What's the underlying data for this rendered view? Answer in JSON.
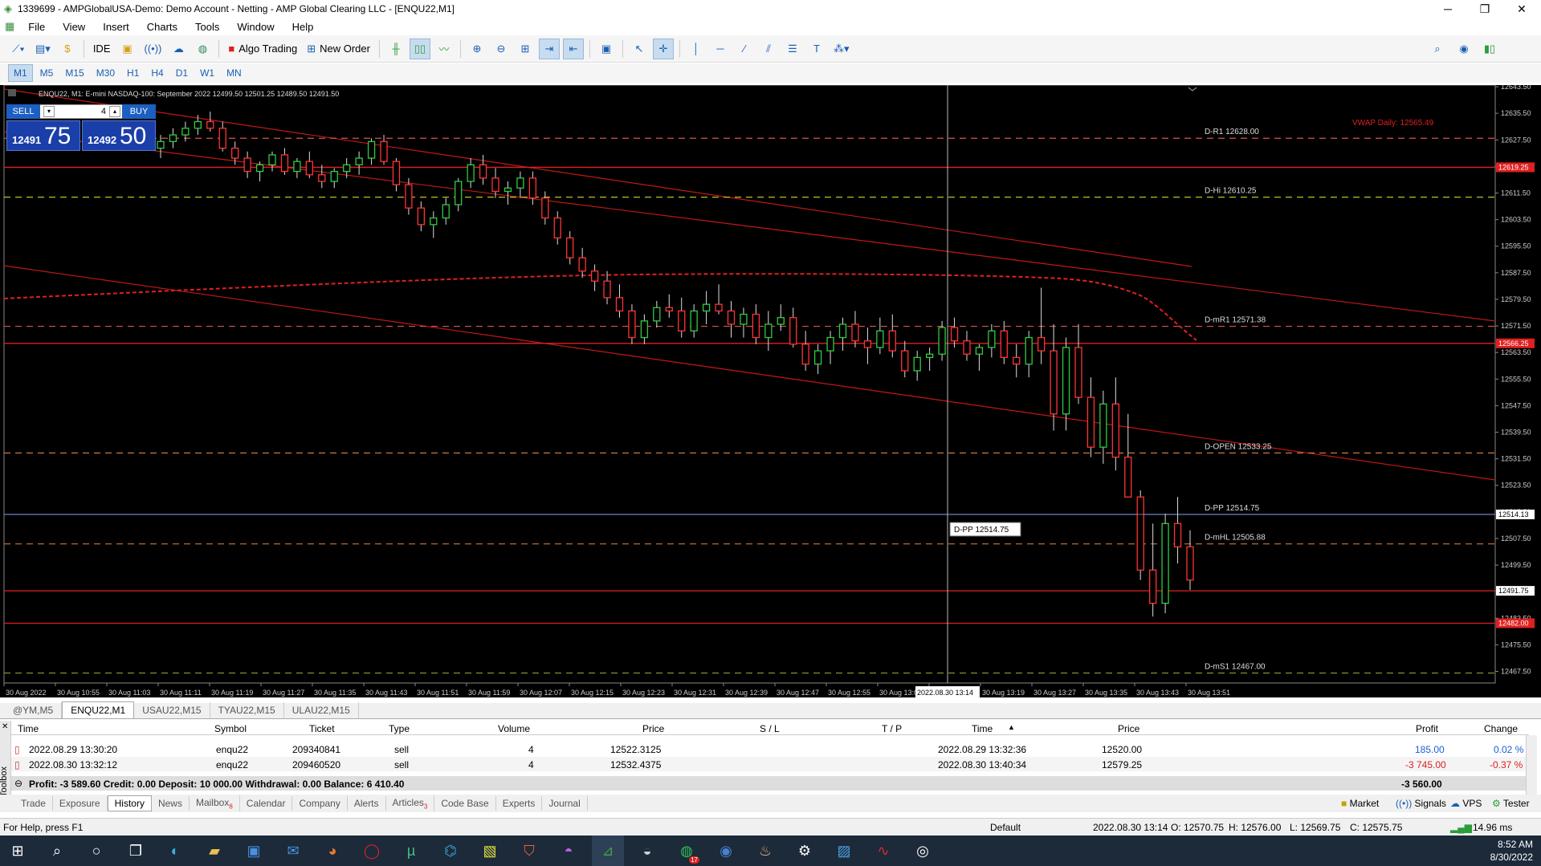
{
  "window": {
    "title": "1339699 - AMPGlobalUSA-Demo: Demo Account - Netting - AMP Global Clearing LLC - [ENQU22,M1]"
  },
  "menu": [
    "File",
    "View",
    "Insert",
    "Charts",
    "Tools",
    "Window",
    "Help"
  ],
  "toolbar": {
    "ide_label": "IDE",
    "algo_label": "Algo Trading",
    "neworder_label": "New Order"
  },
  "timeframes": [
    "M1",
    "M5",
    "M15",
    "M30",
    "H1",
    "H4",
    "D1",
    "W1",
    "MN"
  ],
  "active_timeframe": "M1",
  "chart": {
    "header": "ENQU22, M1:  E-mini NASDAQ-100: September 2022  12499.50 12501.25 12489.50 12491.50",
    "vwap_label": "VWAP Daily: 12565.49",
    "crosshair_label": "D-PP  12514.75",
    "crosshair_time": "2022.08.30 13:14",
    "price_tag_current": "12491.75",
    "price_tag_1": "12619.25",
    "price_tag_2": "12566.25",
    "price_tag_3": "12514.13",
    "price_tag_4": "12482.00"
  },
  "trade_panel": {
    "sell_label": "SELL",
    "buy_label": "BUY",
    "volume": "4",
    "sell_big": "75",
    "sell_small": "12491",
    "buy_big": "50",
    "buy_small": "12492"
  },
  "chart_data": {
    "type": "candlestick",
    "title": "ENQU22, M1: E-mini NASDAQ-100: September 2022",
    "ylim": [
      12464,
      12644
    ],
    "y_ticks": [
      "12643.50",
      "12635.50",
      "12627.50",
      "12619.50",
      "12611.50",
      "12603.50",
      "12595.50",
      "12587.50",
      "12579.50",
      "12571.50",
      "12563.50",
      "12555.50",
      "12547.50",
      "12539.50",
      "12531.50",
      "12523.50",
      "12515.50",
      "12507.50",
      "12499.50",
      "12491.50",
      "12483.50",
      "12475.50",
      "12467.50"
    ],
    "x_ticks": [
      "30 Aug 2022",
      "30 Aug 10:55",
      "30 Aug 11:03",
      "30 Aug 11:11",
      "30 Aug 11:19",
      "30 Aug 11:27",
      "30 Aug 11:35",
      "30 Aug 11:43",
      "30 Aug 11:51",
      "30 Aug 11:59",
      "30 Aug 12:07",
      "30 Aug 12:15",
      "30 Aug 12:23",
      "30 Aug 12:31",
      "30 Aug 12:39",
      "30 Aug 12:47",
      "30 Aug 12:55",
      "30 Aug 13:03",
      "30 Aug 13:11",
      "30 Aug 13:19",
      "30 Aug 13:27",
      "30 Aug 13:35",
      "30 Aug 13:43",
      "30 Aug 13:51"
    ],
    "levels": [
      {
        "name": "D-R1",
        "price": 12628.0,
        "label": "D-R1 12628.00",
        "color": "#d9534f",
        "style": "dash"
      },
      {
        "name": "D-Hi",
        "price": 12610.25,
        "label": "D-Hi 12610.25",
        "color": "#d6d62a",
        "style": "dash"
      },
      {
        "name": "D-mR1",
        "price": 12571.38,
        "label": "D-mR1 12571.38",
        "color": "#d9534f",
        "style": "dash"
      },
      {
        "name": "D-OPEN",
        "price": 12533.25,
        "label": "D-OPEN 12533.25",
        "color": "#c87a3c",
        "style": "dash"
      },
      {
        "name": "D-PP",
        "price": 12514.75,
        "label": "D-PP 12514.75",
        "color": "#3355ff",
        "style": "solid"
      },
      {
        "name": "D-mHL",
        "price": 12505.88,
        "label": "D-mHL 12505.88",
        "color": "#c87a3c",
        "style": "dash"
      },
      {
        "name": "D-mS1",
        "price": 12467.0,
        "label": "D-mS1 12467.00",
        "color": "#8aa030",
        "style": "dash"
      }
    ],
    "hlines": [
      {
        "price": 12619.25,
        "color": "#e02020"
      },
      {
        "price": 12566.25,
        "color": "#e02020"
      },
      {
        "price": 12491.75,
        "color": "#e02020"
      },
      {
        "price": 12482.0,
        "color": "#e02020"
      }
    ],
    "candles": [
      [
        12625,
        12629,
        12622,
        12627
      ],
      [
        12627,
        12631,
        12625,
        12629
      ],
      [
        12629,
        12633,
        12627,
        12631
      ],
      [
        12631,
        12635,
        12629,
        12633
      ],
      [
        12633,
        12636,
        12630,
        12631
      ],
      [
        12631,
        12633,
        12624,
        12625
      ],
      [
        12625,
        12627,
        12620,
        12622
      ],
      [
        12622,
        12624,
        12616,
        12618
      ],
      [
        12618,
        12621,
        12615,
        12620
      ],
      [
        12620,
        12624,
        12618,
        12623
      ],
      [
        12623,
        12625,
        12617,
        12618
      ],
      [
        12618,
        12622,
        12616,
        12621
      ],
      [
        12621,
        12624,
        12616,
        12617
      ],
      [
        12617,
        12620,
        12613,
        12615
      ],
      [
        12615,
        12619,
        12613,
        12618
      ],
      [
        12618,
        12622,
        12616,
        12620
      ],
      [
        12620,
        12624,
        12617,
        12622
      ],
      [
        12622,
        12628,
        12620,
        12627
      ],
      [
        12627,
        12629,
        12620,
        12621
      ],
      [
        12621,
        12622,
        12612,
        12614
      ],
      [
        12614,
        12616,
        12605,
        12607
      ],
      [
        12607,
        12609,
        12600,
        12602
      ],
      [
        12602,
        12606,
        12598,
        12604
      ],
      [
        12604,
        12610,
        12602,
        12608
      ],
      [
        12608,
        12616,
        12606,
        12615
      ],
      [
        12615,
        12622,
        12613,
        12620
      ],
      [
        12620,
        12623,
        12614,
        12616
      ],
      [
        12616,
        12619,
        12610,
        12612
      ],
      [
        12612,
        12615,
        12608,
        12613
      ],
      [
        12613,
        12618,
        12610,
        12616
      ],
      [
        12616,
        12618,
        12608,
        12610
      ],
      [
        12610,
        12612,
        12602,
        12604
      ],
      [
        12604,
        12606,
        12596,
        12598
      ],
      [
        12598,
        12600,
        12590,
        12592
      ],
      [
        12592,
        12595,
        12586,
        12588
      ],
      [
        12588,
        12590,
        12582,
        12585
      ],
      [
        12585,
        12588,
        12578,
        12580
      ],
      [
        12580,
        12584,
        12574,
        12576
      ],
      [
        12576,
        12578,
        12566,
        12568
      ],
      [
        12568,
        12575,
        12566,
        12573
      ],
      [
        12573,
        12579,
        12571,
        12577
      ],
      [
        12577,
        12581,
        12574,
        12576
      ],
      [
        12576,
        12580,
        12568,
        12570
      ],
      [
        12570,
        12578,
        12568,
        12576
      ],
      [
        12576,
        12582,
        12572,
        12578
      ],
      [
        12578,
        12584,
        12575,
        12576
      ],
      [
        12576,
        12579,
        12568,
        12572
      ],
      [
        12572,
        12577,
        12568,
        12575
      ],
      [
        12575,
        12578,
        12566,
        12568
      ],
      [
        12568,
        12576,
        12564,
        12572
      ],
      [
        12572,
        12578,
        12570,
        12574
      ],
      [
        12574,
        12577,
        12565,
        12566
      ],
      [
        12566,
        12570,
        12558,
        12560
      ],
      [
        12560,
        12566,
        12557,
        12564
      ],
      [
        12564,
        12570,
        12560,
        12568
      ],
      [
        12568,
        12574,
        12564,
        12572
      ],
      [
        12572,
        12576,
        12565,
        12567
      ],
      [
        12567,
        12571,
        12560,
        12565
      ],
      [
        12565,
        12574,
        12563,
        12570
      ],
      [
        12570,
        12575,
        12562,
        12564
      ],
      [
        12564,
        12567,
        12556,
        12558
      ],
      [
        12558,
        12564,
        12555,
        12562
      ],
      [
        12562,
        12565,
        12558,
        12563
      ],
      [
        12563,
        12573,
        12561,
        12571
      ],
      [
        12571,
        12574,
        12565,
        12567
      ],
      [
        12567,
        12570,
        12561,
        12563
      ],
      [
        12563,
        12566,
        12558,
        12565
      ],
      [
        12565,
        12572,
        12562,
        12570
      ],
      [
        12570,
        12573,
        12560,
        12562
      ],
      [
        12562,
        12566,
        12556,
        12560
      ],
      [
        12560,
        12570,
        12556,
        12568
      ],
      [
        12568,
        12583,
        12560,
        12564
      ],
      [
        12564,
        12572,
        12540,
        12545
      ],
      [
        12545,
        12568,
        12540,
        12565
      ],
      [
        12565,
        12572,
        12548,
        12550
      ],
      [
        12550,
        12556,
        12532,
        12535
      ],
      [
        12535,
        12552,
        12530,
        12548
      ],
      [
        12548,
        12556,
        12528,
        12532
      ],
      [
        12532,
        12545,
        12524,
        12520
      ],
      [
        12520,
        12522,
        12495,
        12498
      ],
      [
        12498,
        12512,
        12484,
        12488
      ],
      [
        12488,
        12515,
        12485,
        12512
      ],
      [
        12512,
        12520,
        12500,
        12505
      ],
      [
        12505,
        12510,
        12492,
        12495
      ]
    ]
  },
  "chart_tabs": [
    "@YM,M5",
    "ENQU22,M1",
    "USAU22,M15",
    "TYAU22,M15",
    "ULAU22,M15"
  ],
  "active_chart_tab": "ENQU22,M1",
  "history": {
    "columns": [
      "Time",
      "Symbol",
      "Ticket",
      "Type",
      "Volume",
      "Price",
      "S / L",
      "T / P",
      "Time",
      "Price",
      "Profit",
      "Change"
    ],
    "rows": [
      {
        "time": "2022.08.29 13:30:20",
        "symbol": "enqu22",
        "ticket": "209340841",
        "type": "sell",
        "volume": "4",
        "price": "12522.3125",
        "sl": "",
        "tp": "",
        "time2": "2022.08.29 13:32:36",
        "price2": "12520.00",
        "profit": "185.00",
        "change": "0.02 %"
      },
      {
        "time": "2022.08.30 13:32:12",
        "symbol": "enqu22",
        "ticket": "209460520",
        "type": "sell",
        "volume": "4",
        "price": "12532.4375",
        "sl": "",
        "tp": "",
        "time2": "2022.08.30 13:40:34",
        "price2": "12579.25",
        "profit": "-3 745.00",
        "change": "-0.37 %"
      }
    ],
    "summary": "Profit: -3 589.60  Credit: 0.00  Deposit: 10 000.00  Withdrawal: 0.00  Balance: 6 410.40",
    "summary_total": "-3 560.00"
  },
  "bottom_tabs": [
    "Trade",
    "Exposure",
    "History",
    "News",
    "Mailbox",
    "Calendar",
    "Company",
    "Alerts",
    "Articles",
    "Code Base",
    "Experts",
    "Journal"
  ],
  "active_bottom_tab": "History",
  "mailbox_badge": "8",
  "articles_badge": "3",
  "right_tabs": [
    "Market",
    "Signals",
    "VPS",
    "Tester"
  ],
  "toolbox_label": "Toolbox",
  "status": {
    "help": "For Help, press F1",
    "profile": "Default",
    "datetime": "2022.08.30 13:14",
    "open": "O: 12570.75",
    "high": "H: 12576.00",
    "low": "L: 12569.75",
    "close": "C: 12575.75",
    "ping": "14.96 ms"
  },
  "taskbar": {
    "time": "8:52 AM",
    "date": "8/30/2022",
    "mail_badge": "17"
  }
}
